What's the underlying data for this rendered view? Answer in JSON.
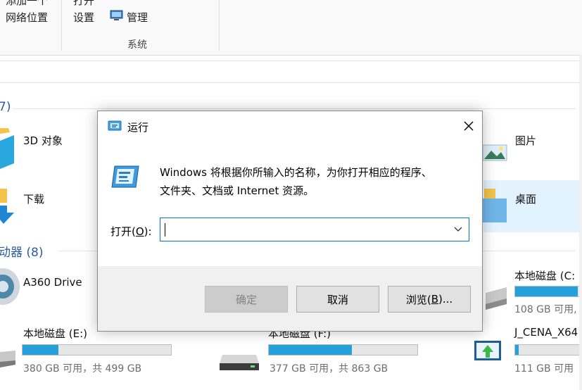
{
  "ribbon": {
    "add_location_line1": "添加一个",
    "add_location_line2": "网络位置",
    "open_line1": "打开",
    "open_line2": "设置",
    "manage_label": "管理",
    "group_label": "系统"
  },
  "sections": {
    "folders_count": "7)",
    "drives_header": "动器 (8)"
  },
  "folders": [
    {
      "label": "3D 对象"
    },
    {
      "label": "下载"
    },
    {
      "label": "图片"
    },
    {
      "label": "桌面"
    }
  ],
  "drives": [
    {
      "name": "A360 Drive"
    },
    {
      "name": "本地磁盘 (C:",
      "free_text": "108 GB 可用,",
      "fill": 0.95
    },
    {
      "name": "本地磁盘 (E:)",
      "free_text": "380 GB 可用，共 499 GB",
      "fill": 0.24
    },
    {
      "name": "本地磁盘 (F:)",
      "free_text": "377 GB 可用，共 863 GB",
      "fill": 0.56
    },
    {
      "name": "J_CENA_X64",
      "free_text": "111 GB 可用",
      "fill": 0.05
    }
  ],
  "dialog": {
    "title": "运行",
    "description_line1": "Windows 将根据你所输入的名称，为你打开相应的程序、",
    "description_line2": "文件夹、文档或 Internet 资源。",
    "open_label_pre": "打开(",
    "open_label_key": "O",
    "open_label_post": "):",
    "input_value": "",
    "ok_label": "确定",
    "cancel_label": "取消",
    "browse_label_pre": "浏览(",
    "browse_label_key": "B",
    "browse_label_post": ")..."
  },
  "colors": {
    "accent": "#0078d7",
    "drive_bar": "#26a0da",
    "section_header": "#2a5d9f"
  }
}
